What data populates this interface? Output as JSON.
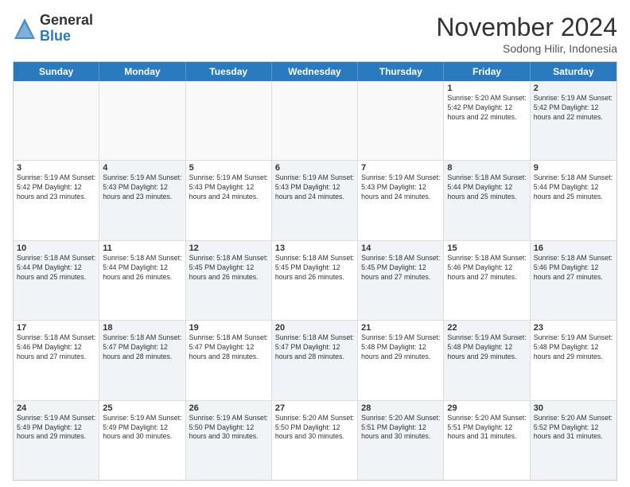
{
  "header": {
    "logo_general": "General",
    "logo_blue": "Blue",
    "month_title": "November 2024",
    "subtitle": "Sodong Hilir, Indonesia"
  },
  "days_of_week": [
    "Sunday",
    "Monday",
    "Tuesday",
    "Wednesday",
    "Thursday",
    "Friday",
    "Saturday"
  ],
  "weeks": [
    [
      {
        "day": "",
        "info": "",
        "empty": true
      },
      {
        "day": "",
        "info": "",
        "empty": true
      },
      {
        "day": "",
        "info": "",
        "empty": true
      },
      {
        "day": "",
        "info": "",
        "empty": true
      },
      {
        "day": "",
        "info": "",
        "empty": true
      },
      {
        "day": "1",
        "info": "Sunrise: 5:20 AM\nSunset: 5:42 PM\nDaylight: 12 hours\nand 22 minutes."
      },
      {
        "day": "2",
        "info": "Sunrise: 5:19 AM\nSunset: 5:42 PM\nDaylight: 12 hours\nand 22 minutes.",
        "shaded": true
      }
    ],
    [
      {
        "day": "3",
        "info": "Sunrise: 5:19 AM\nSunset: 5:42 PM\nDaylight: 12 hours\nand 23 minutes."
      },
      {
        "day": "4",
        "info": "Sunrise: 5:19 AM\nSunset: 5:43 PM\nDaylight: 12 hours\nand 23 minutes.",
        "shaded": true
      },
      {
        "day": "5",
        "info": "Sunrise: 5:19 AM\nSunset: 5:43 PM\nDaylight: 12 hours\nand 24 minutes."
      },
      {
        "day": "6",
        "info": "Sunrise: 5:19 AM\nSunset: 5:43 PM\nDaylight: 12 hours\nand 24 minutes.",
        "shaded": true
      },
      {
        "day": "7",
        "info": "Sunrise: 5:19 AM\nSunset: 5:43 PM\nDaylight: 12 hours\nand 24 minutes."
      },
      {
        "day": "8",
        "info": "Sunrise: 5:18 AM\nSunset: 5:44 PM\nDaylight: 12 hours\nand 25 minutes.",
        "shaded": true
      },
      {
        "day": "9",
        "info": "Sunrise: 5:18 AM\nSunset: 5:44 PM\nDaylight: 12 hours\nand 25 minutes."
      }
    ],
    [
      {
        "day": "10",
        "info": "Sunrise: 5:18 AM\nSunset: 5:44 PM\nDaylight: 12 hours\nand 25 minutes.",
        "shaded": true
      },
      {
        "day": "11",
        "info": "Sunrise: 5:18 AM\nSunset: 5:44 PM\nDaylight: 12 hours\nand 26 minutes."
      },
      {
        "day": "12",
        "info": "Sunrise: 5:18 AM\nSunset: 5:45 PM\nDaylight: 12 hours\nand 26 minutes.",
        "shaded": true
      },
      {
        "day": "13",
        "info": "Sunrise: 5:18 AM\nSunset: 5:45 PM\nDaylight: 12 hours\nand 26 minutes."
      },
      {
        "day": "14",
        "info": "Sunrise: 5:18 AM\nSunset: 5:45 PM\nDaylight: 12 hours\nand 27 minutes.",
        "shaded": true
      },
      {
        "day": "15",
        "info": "Sunrise: 5:18 AM\nSunset: 5:46 PM\nDaylight: 12 hours\nand 27 minutes."
      },
      {
        "day": "16",
        "info": "Sunrise: 5:18 AM\nSunset: 5:46 PM\nDaylight: 12 hours\nand 27 minutes.",
        "shaded": true
      }
    ],
    [
      {
        "day": "17",
        "info": "Sunrise: 5:18 AM\nSunset: 5:46 PM\nDaylight: 12 hours\nand 27 minutes."
      },
      {
        "day": "18",
        "info": "Sunrise: 5:18 AM\nSunset: 5:47 PM\nDaylight: 12 hours\nand 28 minutes.",
        "shaded": true
      },
      {
        "day": "19",
        "info": "Sunrise: 5:18 AM\nSunset: 5:47 PM\nDaylight: 12 hours\nand 28 minutes."
      },
      {
        "day": "20",
        "info": "Sunrise: 5:18 AM\nSunset: 5:47 PM\nDaylight: 12 hours\nand 28 minutes.",
        "shaded": true
      },
      {
        "day": "21",
        "info": "Sunrise: 5:19 AM\nSunset: 5:48 PM\nDaylight: 12 hours\nand 29 minutes."
      },
      {
        "day": "22",
        "info": "Sunrise: 5:19 AM\nSunset: 5:48 PM\nDaylight: 12 hours\nand 29 minutes.",
        "shaded": true
      },
      {
        "day": "23",
        "info": "Sunrise: 5:19 AM\nSunset: 5:48 PM\nDaylight: 12 hours\nand 29 minutes."
      }
    ],
    [
      {
        "day": "24",
        "info": "Sunrise: 5:19 AM\nSunset: 5:49 PM\nDaylight: 12 hours\nand 29 minutes.",
        "shaded": true
      },
      {
        "day": "25",
        "info": "Sunrise: 5:19 AM\nSunset: 5:49 PM\nDaylight: 12 hours\nand 30 minutes."
      },
      {
        "day": "26",
        "info": "Sunrise: 5:19 AM\nSunset: 5:50 PM\nDaylight: 12 hours\nand 30 minutes.",
        "shaded": true
      },
      {
        "day": "27",
        "info": "Sunrise: 5:20 AM\nSunset: 5:50 PM\nDaylight: 12 hours\nand 30 minutes."
      },
      {
        "day": "28",
        "info": "Sunrise: 5:20 AM\nSunset: 5:51 PM\nDaylight: 12 hours\nand 30 minutes.",
        "shaded": true
      },
      {
        "day": "29",
        "info": "Sunrise: 5:20 AM\nSunset: 5:51 PM\nDaylight: 12 hours\nand 31 minutes."
      },
      {
        "day": "30",
        "info": "Sunrise: 5:20 AM\nSunset: 5:52 PM\nDaylight: 12 hours\nand 31 minutes.",
        "shaded": true
      }
    ]
  ]
}
